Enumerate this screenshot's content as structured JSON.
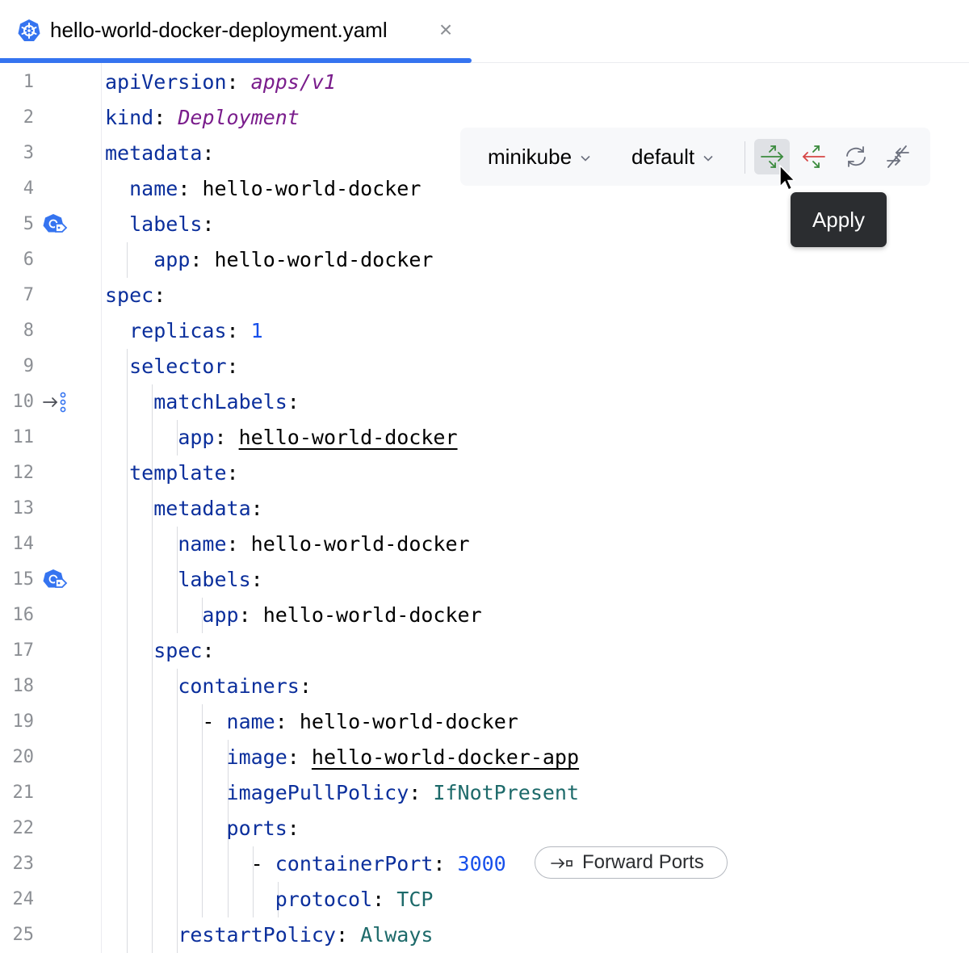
{
  "tab": {
    "title": "hello-world-docker-deployment.yaml",
    "close_glyph": "×",
    "icon": "kubernetes-icon",
    "accent": "#3574f0"
  },
  "toolbar": {
    "context": "minikube",
    "namespace": "default",
    "buttons": [
      {
        "name": "apply-icon",
        "active": true
      },
      {
        "name": "reload-from-cluster-icon",
        "active": false
      },
      {
        "name": "refresh-icon",
        "active": false
      },
      {
        "name": "compare-icon",
        "active": false
      }
    ],
    "tooltip": "Apply"
  },
  "inlay": {
    "forward_ports_label": "Forward Ports"
  },
  "lines": [
    {
      "n": "1",
      "indent": 0,
      "key": "apiVersion",
      "value": "apps/v1",
      "vtype": "vi"
    },
    {
      "n": "2",
      "indent": 0,
      "key": "kind",
      "value": "Deployment",
      "vtype": "vi"
    },
    {
      "n": "3",
      "indent": 0,
      "key": "metadata",
      "value": "",
      "vtype": "v"
    },
    {
      "n": "4",
      "indent": 1,
      "key": "name",
      "value": "hello-world-docker",
      "vtype": "v"
    },
    {
      "n": "5",
      "indent": 1,
      "key": "labels",
      "value": "",
      "vtype": "v",
      "gutter": "label-selector-icon"
    },
    {
      "n": "6",
      "indent": 2,
      "key": "app",
      "value": "hello-world-docker",
      "vtype": "v"
    },
    {
      "n": "7",
      "indent": 0,
      "key": "spec",
      "value": "",
      "vtype": "v"
    },
    {
      "n": "8",
      "indent": 1,
      "key": "replicas",
      "value": "1",
      "vtype": "vn"
    },
    {
      "n": "9",
      "indent": 1,
      "key": "selector",
      "value": "",
      "vtype": "v"
    },
    {
      "n": "10",
      "indent": 2,
      "key": "matchLabels",
      "value": "",
      "vtype": "v",
      "gutter": "navigate-to-pods-icon"
    },
    {
      "n": "11",
      "indent": 3,
      "key": "app",
      "value": "hello-world-docker",
      "vtype": "v",
      "underline": true
    },
    {
      "n": "12",
      "indent": 1,
      "key": "template",
      "value": "",
      "vtype": "v"
    },
    {
      "n": "13",
      "indent": 2,
      "key": "metadata",
      "value": "",
      "vtype": "v"
    },
    {
      "n": "14",
      "indent": 3,
      "key": "name",
      "value": "hello-world-docker",
      "vtype": "v"
    },
    {
      "n": "15",
      "indent": 3,
      "key": "labels",
      "value": "",
      "vtype": "v",
      "gutter": "label-selector-icon"
    },
    {
      "n": "16",
      "indent": 4,
      "key": "app",
      "value": "hello-world-docker",
      "vtype": "v"
    },
    {
      "n": "17",
      "indent": 2,
      "key": "spec",
      "value": "",
      "vtype": "v"
    },
    {
      "n": "18",
      "indent": 3,
      "key": "containers",
      "value": "",
      "vtype": "v"
    },
    {
      "n": "19",
      "indent": 4,
      "dash": true,
      "key": "name",
      "value": "hello-world-docker",
      "vtype": "v"
    },
    {
      "n": "20",
      "indent": 5,
      "key": "image",
      "value": "hello-world-docker-app",
      "vtype": "v",
      "underline": true
    },
    {
      "n": "21",
      "indent": 5,
      "key": "imagePullPolicy",
      "value": "IfNotPresent",
      "vtype": "vc"
    },
    {
      "n": "22",
      "indent": 5,
      "key": "ports",
      "value": "",
      "vtype": "v"
    },
    {
      "n": "23",
      "indent": 6,
      "dash": true,
      "key": "containerPort",
      "value": "3000",
      "vtype": "vn"
    },
    {
      "n": "24",
      "indent": 7,
      "key": "protocol",
      "value": "TCP",
      "vtype": "vc"
    },
    {
      "n": "25",
      "indent": 3,
      "key": "restartPolicy",
      "value": "Always",
      "vtype": "vc"
    }
  ]
}
